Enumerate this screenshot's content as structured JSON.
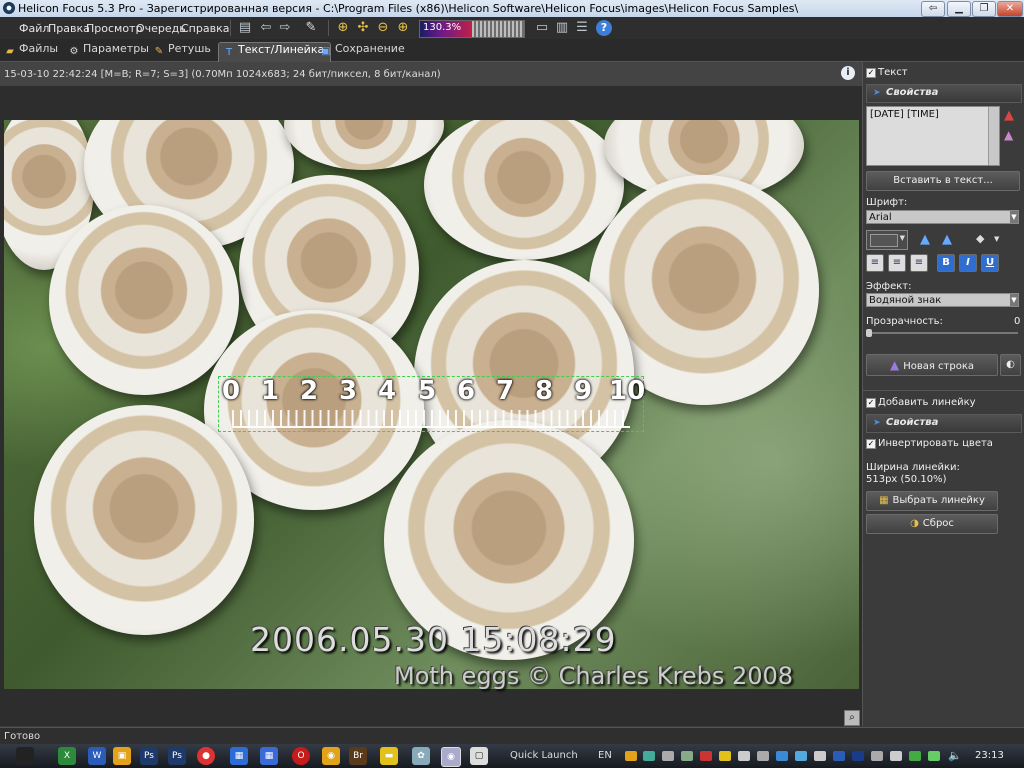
{
  "window": {
    "title": "Helicon Focus 5.3 Pro - Зарегистрированная версия - C:\\Program Files (x86)\\Helicon Software\\Helicon Focus\\images\\Helicon Focus Samples\\",
    "controls": [
      "minimize",
      "maximize",
      "close"
    ]
  },
  "menu": {
    "items": [
      "Файл",
      "Правка",
      "Просмотр",
      "Очередь",
      "Справка"
    ],
    "zoom_value": "130.3%",
    "zoom_level": 0.5
  },
  "tabs": [
    {
      "label": "Файлы",
      "icon": "folder-icon"
    },
    {
      "label": "Параметры",
      "icon": "gear-icon"
    },
    {
      "label": "Ретушь",
      "icon": "brush-icon"
    },
    {
      "label": "Текст/Линейка",
      "icon": "text-icon",
      "active": true
    },
    {
      "label": "Сохранение",
      "icon": "save-icon"
    }
  ],
  "info": {
    "text": "15-03-10 22:42:24 [M=B; R=7; S=3] (0.70Мп 1024x683; 24 бит/пиксел, 8 бит/канал)"
  },
  "image": {
    "ruler_numbers": [
      "0",
      "1",
      "2",
      "3",
      "4",
      "5",
      "6",
      "7",
      "8",
      "9",
      "10"
    ],
    "stamp_date": "2006.05.30 15:08:29",
    "stamp_credit": "Moth eggs © Charles Krebs 2008"
  },
  "panel": {
    "text_checkbox": "Текст",
    "properties_header": "Свойства",
    "text_content": "[DATE] [TIME]",
    "insert_button": "Вставить в текст...",
    "font_label": "Шрифт:",
    "font_value": "Arial",
    "effect_label": "Эффект:",
    "effect_value": "Водяной знак",
    "opacity_label": "Прозрачность:",
    "opacity_value": "0",
    "new_line_button": "Новая строка",
    "add_ruler_checkbox": "Добавить линейку",
    "ruler_properties_header": "Свойства",
    "invert_colors_checkbox": "Инвертировать цвета",
    "ruler_width_label": "Ширина линейки:",
    "ruler_width_value": "513px (50.10%)",
    "choose_ruler_button": "Выбрать линейку",
    "reset_button": "Сброс"
  },
  "status": {
    "text": "Готово"
  },
  "taskbar": {
    "quick_launch": "Quick Launch",
    "language": "EN",
    "time": "23:13"
  }
}
